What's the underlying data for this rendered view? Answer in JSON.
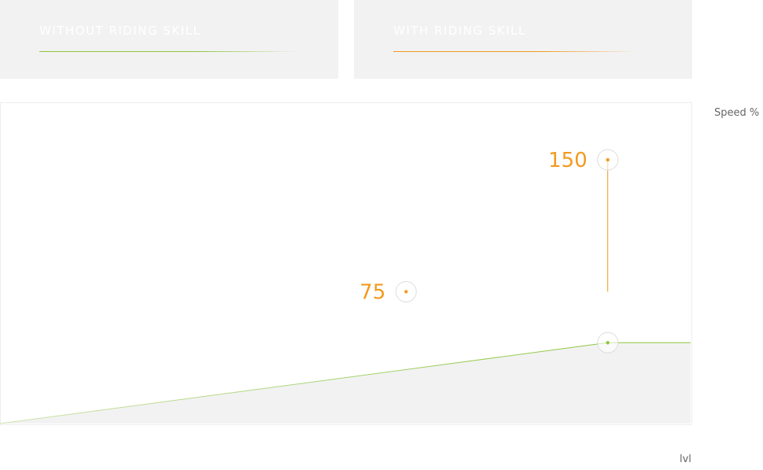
{
  "tabs": [
    {
      "label": "WITHOUT RIDING SKILL",
      "color": "#8dc63f"
    },
    {
      "label": "WITH RIDING SKILL",
      "color": "#f39a1e"
    }
  ],
  "chart_data": {
    "type": "line",
    "xlabel": "lvl",
    "ylabel": "Speed %",
    "ylim": [
      0,
      180
    ],
    "grid": true,
    "series": [
      {
        "color": "#8dc63f",
        "points": [
          [
            0,
            0
          ],
          [
            0.88,
            46
          ],
          [
            1.0,
            46
          ]
        ],
        "marker_index": 1,
        "fill": true
      },
      {
        "color": "#f39a1e",
        "points": [
          [
            0.588,
            75
          ],
          [
            0.88,
            75
          ],
          [
            0.88,
            150
          ]
        ],
        "markers": [
          {
            "index": 0,
            "label": "75"
          },
          {
            "index": 2,
            "label": "150"
          }
        ]
      }
    ]
  }
}
